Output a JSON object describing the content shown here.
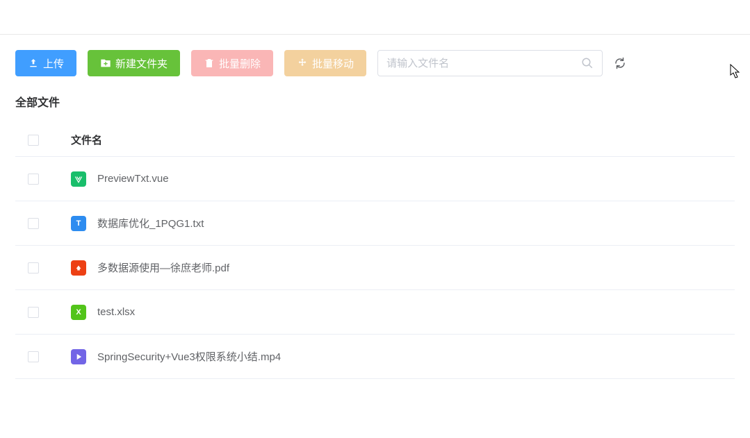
{
  "toolbar": {
    "upload_label": "上传",
    "new_folder_label": "新建文件夹",
    "batch_delete_label": "批量删除",
    "batch_move_label": "批量移动"
  },
  "search": {
    "placeholder": "请输入文件名"
  },
  "breadcrumb": {
    "label": "全部文件"
  },
  "table": {
    "header_filename": "文件名"
  },
  "files": [
    {
      "name": "PreviewTxt.vue",
      "type": "vue"
    },
    {
      "name": "数据库优化_1PQG1.txt",
      "type": "txt"
    },
    {
      "name": "多数据源使用—徐庶老师.pdf",
      "type": "pdf"
    },
    {
      "name": "test.xlsx",
      "type": "xlsx"
    },
    {
      "name": "SpringSecurity+Vue3权限系统小结.mp4",
      "type": "mp4"
    }
  ]
}
